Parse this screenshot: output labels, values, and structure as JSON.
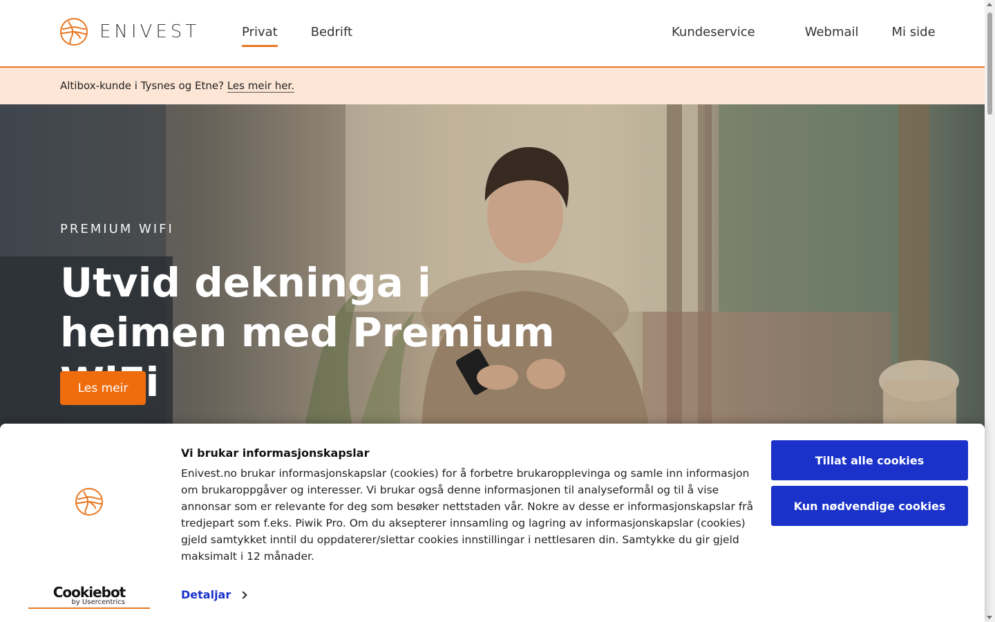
{
  "brand": {
    "name": "ENIVEST",
    "accent": "#e8761f",
    "logo_icon": "enivest-globe-icon"
  },
  "nav": {
    "left": [
      {
        "label": "Privat",
        "active": true
      },
      {
        "label": "Bedrift",
        "active": false
      }
    ],
    "right": [
      {
        "label": "Kundeservice"
      },
      {
        "label": "Webmail"
      },
      {
        "label": "Mi side"
      }
    ]
  },
  "notice": {
    "text": "Altibox-kunde i Tysnes og Etne?",
    "link": "Les meir her."
  },
  "hero": {
    "eyebrow": "PREMIUM WIFI",
    "title": "Utvid dekninga i heimen med Premium WiFi",
    "button": "Les meir",
    "button_color": "#f06d0e"
  },
  "cookie": {
    "title": "Vi brukar informasjonskapslar",
    "text": "Enivest.no brukar informasjonskapslar (cookies) for å forbetre brukaropplevinga og samle inn informasjon om brukaroppgåver og interesser. Vi brukar også denne informasjonen til analyseformål og til å vise annonsar som er relevante for deg som besøker nettstaden vår. Nokre av desse er informasjonskapslar frå tredjepart som f.eks. Piwik Pro. Om du aksepterer innsamling og lagring av informasjonskapslar (cookies) gjeld samtykket inntil du oppdaterer/slettar cookies innstillingar i nettlesaren din. Samtykke du gir gjeld maksimalt i 12 månader.",
    "details": "Detaljar",
    "accept_all": "Tillat alle cookies",
    "necessary_only": "Kun nødvendige cookies",
    "button_color": "#1a32c9",
    "provider": "Cookiebot",
    "provider_sub": "by Usercentrics"
  }
}
